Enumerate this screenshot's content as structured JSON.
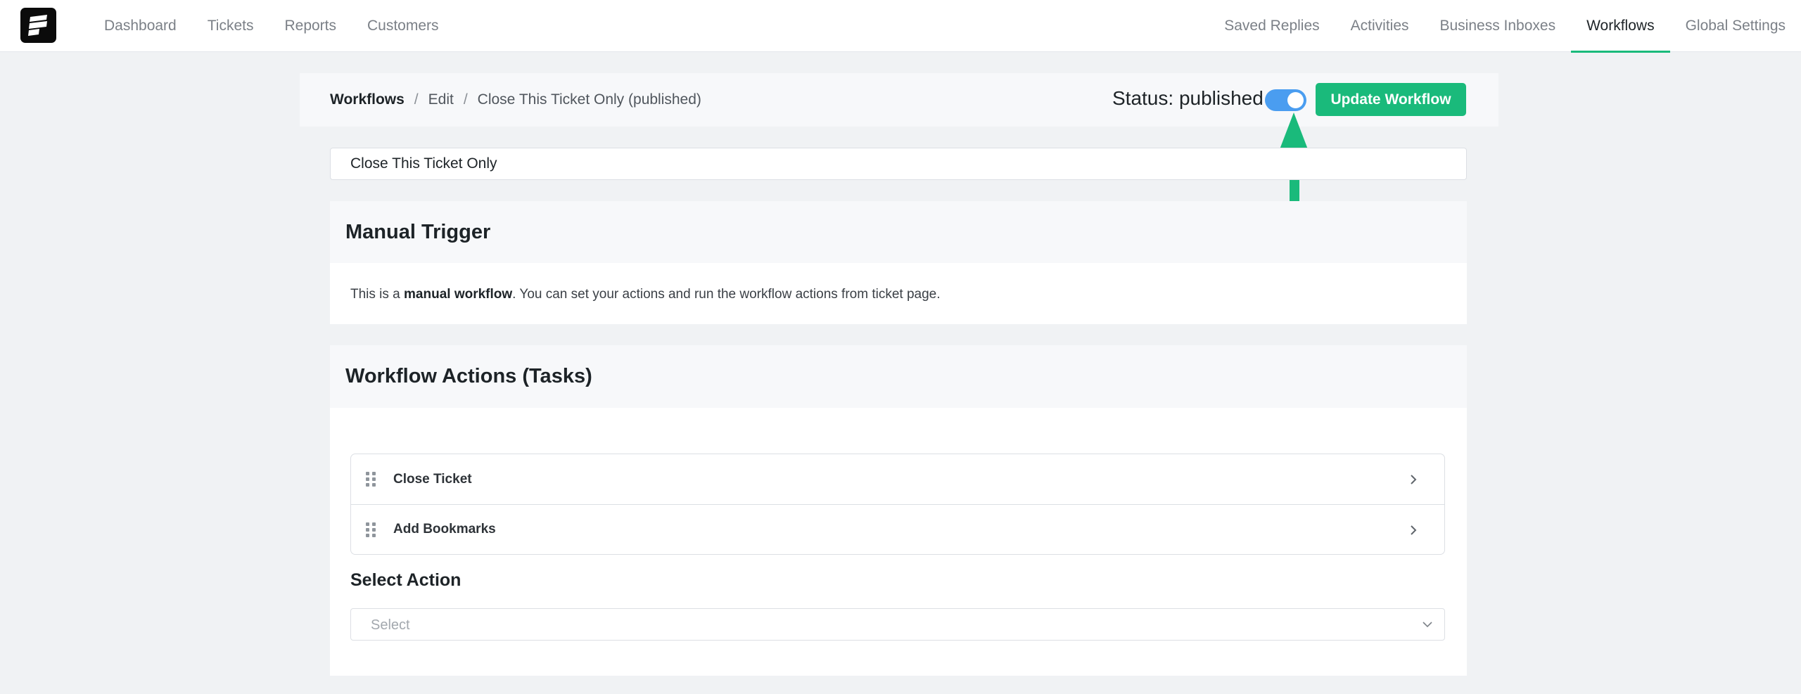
{
  "nav": {
    "left_items": [
      {
        "label": "Dashboard"
      },
      {
        "label": "Tickets"
      },
      {
        "label": "Reports"
      },
      {
        "label": "Customers"
      }
    ],
    "right_items": [
      {
        "label": "Saved Replies"
      },
      {
        "label": "Activities"
      },
      {
        "label": "Business Inboxes"
      },
      {
        "label": "Workflows",
        "active": true
      },
      {
        "label": "Global Settings"
      }
    ]
  },
  "breadcrumb": {
    "root": "Workflows",
    "separator": "/",
    "edit": "Edit",
    "current": "Close This Ticket Only (published)"
  },
  "status": {
    "label": "Status: published",
    "toggle_on": true
  },
  "update_button": "Update Workflow",
  "workflow_title": "Close This Ticket Only",
  "trigger": {
    "heading": "Manual Trigger",
    "text_prefix": "This is a ",
    "text_bold": "manual workflow",
    "text_suffix": ". You can set your actions and run the workflow actions from ticket page."
  },
  "actions": {
    "heading": "Workflow Actions (Tasks)",
    "tasks": [
      {
        "label": "Close Ticket"
      },
      {
        "label": "Add Bookmarks"
      }
    ],
    "select_label": "Select Action",
    "select_placeholder": "Select"
  },
  "colors": {
    "accent": "#1aba7b",
    "toggle": "#4a9df0",
    "background": "#f0f2f4"
  },
  "icons": {
    "logo": "brand-logo-icon",
    "arrow": "arrow-up-annotation-icon",
    "drag": "drag-handle-icon",
    "chevron_right": "chevron-right-icon",
    "chevron_down": "chevron-down-icon"
  }
}
